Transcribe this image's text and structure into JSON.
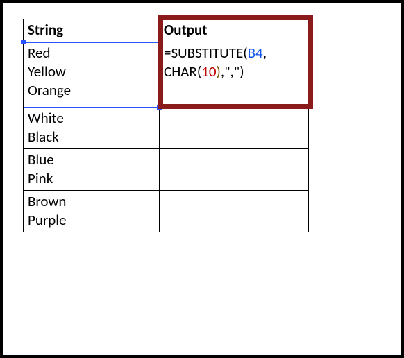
{
  "headers": {
    "string": "String",
    "output": "Output"
  },
  "rows": [
    {
      "string_lines": [
        "Red",
        "Yellow",
        "Orange"
      ]
    },
    {
      "string_lines": [
        "White",
        "Black"
      ]
    },
    {
      "string_lines": [
        "Blue",
        "Pink"
      ]
    },
    {
      "string_lines": [
        "Brown",
        "Purple"
      ]
    }
  ],
  "formula": {
    "raw": "=SUBSTITUTE(B4,CHAR(10),\",\")",
    "tokens": [
      {
        "t": "=SUBSTITUTE",
        "cls": "tk-plain"
      },
      {
        "t": "(",
        "cls": "tk-paren-o"
      },
      {
        "t": "B4",
        "cls": "tk-ref"
      },
      {
        "t": ",",
        "cls": "tk-plain"
      },
      {
        "t": "\n",
        "cls": "tk-plain"
      },
      {
        "t": "CHAR",
        "cls": "tk-plain"
      },
      {
        "t": "(",
        "cls": "tk-paren-o"
      },
      {
        "t": "10",
        "cls": "tk-num"
      },
      {
        "t": ")",
        "cls": "tk-brack-c"
      },
      {
        "t": ",\",\"",
        "cls": "tk-plain"
      },
      {
        "t": ")",
        "cls": "tk-paren-c"
      }
    ]
  },
  "colors": {
    "selection_ref": "#2a54ff",
    "highlight_box": "#8b1a1a"
  }
}
